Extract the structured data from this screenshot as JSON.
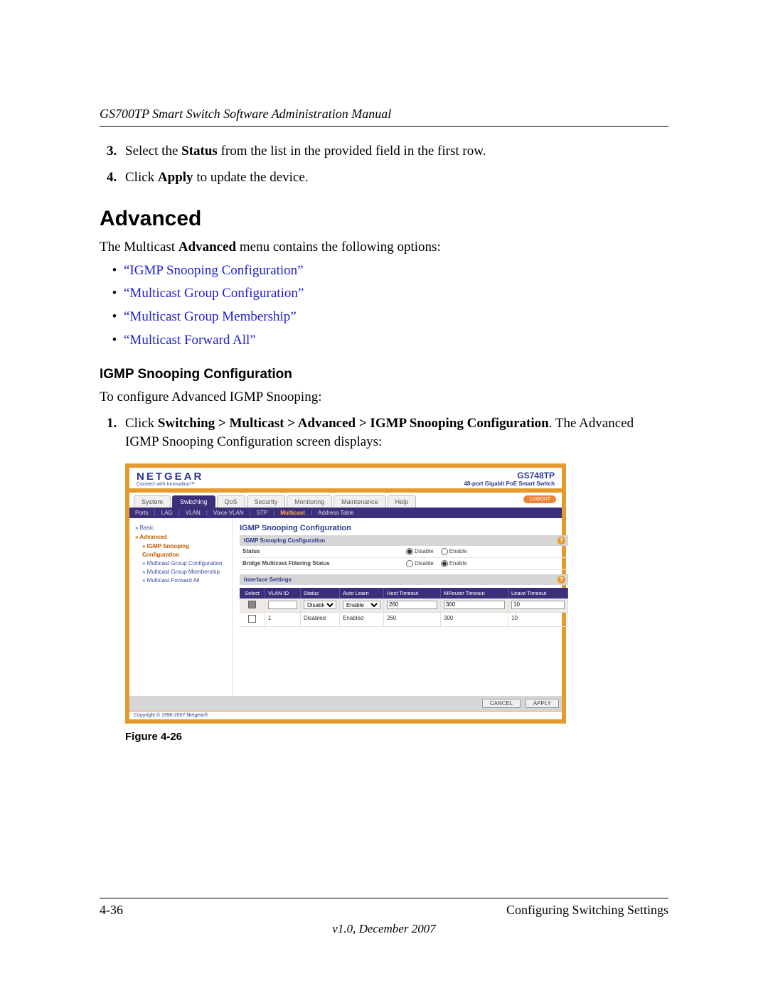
{
  "doc": {
    "running_head": "GS700TP Smart Switch Software Administration Manual",
    "steps_top": [
      {
        "num": "3.",
        "pre": "Select the ",
        "b1": "Status",
        "post": " from the list in the provided field in the first row."
      },
      {
        "num": "4.",
        "pre": "Click ",
        "b1": "Apply",
        "post": " to update the device."
      }
    ],
    "h1": "Advanced",
    "intro_pre": "The Multicast ",
    "intro_b": "Advanced",
    "intro_post": " menu contains the following options:",
    "bullets": [
      "“IGMP Snooping Configuration”",
      "“Multicast Group Configuration”",
      "“Multicast Group Membership”",
      "“Multicast Forward All”"
    ],
    "h2": "IGMP Snooping Configuration",
    "h2_intro": "To configure Advanced IGMP Snooping:",
    "step1": {
      "num": "1.",
      "pre": "Click ",
      "path": "Switching > Multicast > Advanced > IGMP Snooping Configuration",
      "post1": ". The Advanced IGMP Snooping Configuration screen displays:"
    },
    "figcaption": "Figure 4-26",
    "page_num": "4-36",
    "section": "Configuring Switching Settings",
    "version": "v1.0, December 2007"
  },
  "shot": {
    "brand": {
      "logo": "NETGEAR",
      "tag": "Connect with Innovation™",
      "model": "GS748TP",
      "desc": "48-port Gigabit PoE Smart Switch"
    },
    "tabs": [
      "System",
      "Switching",
      "QoS",
      "Security",
      "Monitoring",
      "Maintenance",
      "Help"
    ],
    "active_tab": "Switching",
    "logout": "LOGOUT",
    "subnav": [
      "Ports",
      "LAG",
      "VLAN",
      "Voice VLAN",
      "STP",
      "Multicast",
      "Address Table"
    ],
    "subnav_active": "Multicast",
    "side": {
      "basic": "Basic",
      "advanced": "Advanced",
      "items": [
        {
          "label": "IGMP Snooping Configuration",
          "sel": true
        },
        {
          "label": "Multicast Group Configuration",
          "sel": false
        },
        {
          "label": "Multicast Group Membership",
          "sel": false
        },
        {
          "label": "Multicast Forward All",
          "sel": false
        }
      ]
    },
    "panel": {
      "title": "IGMP Snooping Configuration",
      "sec1": "IGMP Snooping Configuration",
      "row1_label": "Status",
      "row2_label": "Bridge Multicast Filtering Status",
      "opt_disable": "Disable",
      "opt_enable": "Enable",
      "row1_sel": "Disable",
      "row2_sel": "Enable",
      "sec2": "Interface Settings",
      "cols": [
        "Select",
        "VLAN ID",
        "Status",
        "Auto Learn",
        "Host Timeout",
        "MRouter Timeout",
        "Leave Timeout"
      ],
      "editrow": {
        "status": "Disable",
        "auto": "Enable",
        "host": "260",
        "mr": "300",
        "leave": "10"
      },
      "datarow": {
        "vlan": "1",
        "status": "Disabled",
        "auto": "Enabled",
        "host": "260",
        "mr": "300",
        "leave": "10"
      },
      "qmark": "?"
    },
    "footer": {
      "cancel": "CANCEL",
      "apply": "APPLY"
    },
    "copyright": "Copyright © 1996-2007 Netgear®"
  }
}
